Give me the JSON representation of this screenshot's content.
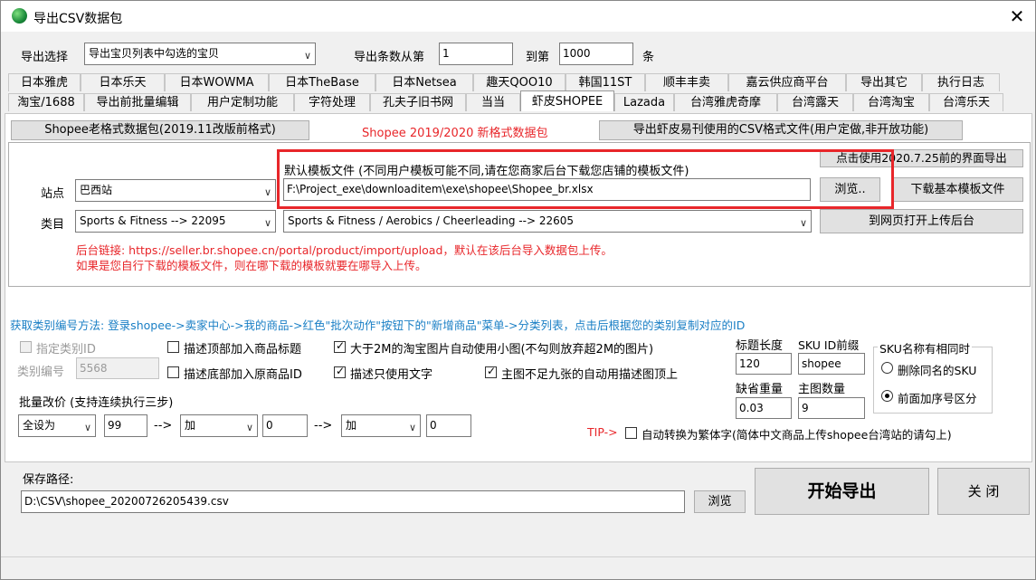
{
  "window": {
    "title": "导出CSV数据包",
    "close_glyph": "✕"
  },
  "export_select": {
    "label": "导出选择",
    "selected": "导出宝贝列表中勾选的宝贝",
    "range_from_label": "导出条数从第",
    "from_value": "1",
    "range_to_label": "到第",
    "to_value": "1000",
    "unit": "条"
  },
  "tabs": {
    "row1": [
      "日本雅虎",
      "日本乐天",
      "日本WOWMA",
      "日本TheBase",
      "日本Netsea",
      "趣天QOO10",
      "韩国11ST",
      "顺丰丰卖",
      "嘉云供应商平台",
      "导出其它",
      "执行日志"
    ],
    "row2": [
      "淘宝/1688",
      "导出前批量编辑",
      "用户定制功能",
      "字符处理",
      "孔夫子旧书网",
      "当当",
      "虾皮SHOPEE",
      "Lazada",
      "台湾雅虎奇摩",
      "台湾露天",
      "台湾淘宝",
      "台湾乐天"
    ],
    "active": "虾皮SHOPEE"
  },
  "format_buttons": {
    "old_format": "Shopee老格式数据包(2019.11改版前格式)",
    "new_format": "Shopee 2019/2020 新格式数据包",
    "yikan": "导出虾皮易刊使用的CSV格式文件(用户定做,非开放功能)"
  },
  "template": {
    "label": "默认模板文件 (不同用户模板可能不同,请在您商家后台下载您店铺的模板文件)",
    "path": "F:\\Project_exe\\downloaditem\\exe\\shopee\\Shopee_br.xlsx",
    "browse": "浏览..",
    "legacy_ui": "点击使用2020.7.25前的界面导出",
    "download_basic": "下载基本模板文件",
    "open_backend": "到网页打开上传后台"
  },
  "site": {
    "label": "站点",
    "value": "巴西站"
  },
  "category": {
    "label": "类目",
    "main": "Sports & Fitness --> 22095",
    "sub": "Sports & Fitness / Aerobics / Cheerleading --> 22605"
  },
  "backend_note": {
    "line1": "后台链接: https://seller.br.shopee.cn/portal/product/import/upload，默认在该后台导入数据包上传。",
    "line2": "如果是您自行下载的模板文件，则在哪下载的模板就要在哪导入上传。"
  },
  "category_hint": "获取类别编号方法: 登录shopee->卖家中心->我的商品->红色\"批次动作\"按钮下的\"新增商品\"菜单->分类列表，点击后根据您的类别复制对应的ID",
  "options": {
    "specify_category_id": "指定类别ID",
    "category_no_label": "类别编号",
    "category_no_value": "5568",
    "desc_top_title": "描述顶部加入商品标题",
    "desc_bottom_id": "描述底部加入原商品ID",
    "auto_small_image": "大于2M的淘宝图片自动使用小图(不勾则放弃超2M的图片)",
    "desc_text_only": "描述只使用文字",
    "main_img_fill": "主图不足九张的自动用描述图顶上",
    "title_length_label": "标题长度",
    "title_length_value": "120",
    "sku_prefix_label": "SKU ID前缀",
    "sku_prefix_value": "shopee",
    "default_weight_label": "缺省重量",
    "default_weight_value": "0.03",
    "main_img_count_label": "主图数量",
    "main_img_count_value": "9",
    "sku_same_name_title": "SKU名称有相同时",
    "sku_delete_same": "删除同名的SKU",
    "sku_prefix_seq": "前面加序号区分"
  },
  "batch_price": {
    "label": "批量改价 (支持连续执行三步)",
    "scope": "全设为",
    "value1": "99",
    "arrow1": "-->",
    "op1": "加",
    "value2": "0",
    "arrow2": "-->",
    "op2": "加",
    "value3": "0"
  },
  "tip": {
    "prefix": "TIP->",
    "text": "自动转换为繁体字(简体中文商品上传shopee台湾站的请勾上)"
  },
  "save": {
    "label": "保存路径:",
    "path": "D:\\CSV\\shopee_20200726205439.csv",
    "browse": "浏览",
    "start": "开始导出",
    "close": "关 闭"
  },
  "colors": {
    "highlight_box": "#e8262a",
    "note_red": "#e8262a",
    "hint_blue": "#1a7fc5"
  }
}
